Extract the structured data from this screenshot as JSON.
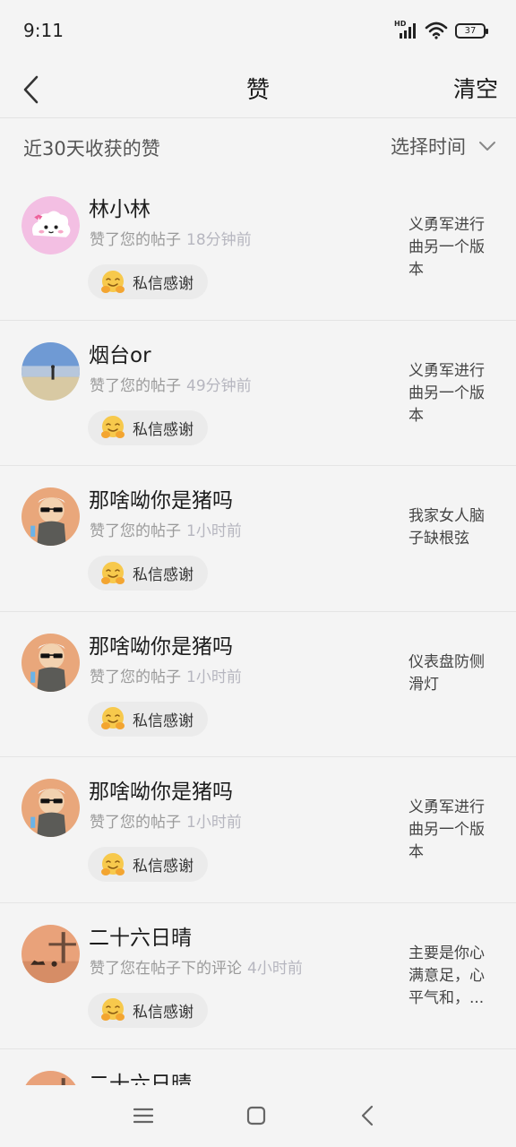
{
  "status_bar": {
    "time": "9:11",
    "network": "HD",
    "battery": "37"
  },
  "header": {
    "title": "赞",
    "clear": "清空"
  },
  "filter": {
    "label": "近30天收获的赞",
    "time_picker": "选择时间"
  },
  "likes": [
    {
      "user": "林小林",
      "action": "赞了您的帖子",
      "time": "18分钟前",
      "thanks": "私信感谢",
      "post": "义勇军进行曲另一个版本",
      "avatar": "cloud"
    },
    {
      "user": "烟台or",
      "action": "赞了您的帖子",
      "time": "49分钟前",
      "thanks": "私信感谢",
      "post": "义勇军进行曲另一个版本",
      "avatar": "beach"
    },
    {
      "user": "那啥呦你是猪吗",
      "action": "赞了您的帖子",
      "time": "1小时前",
      "thanks": "私信感谢",
      "post": "我家女人脑子缺根弦",
      "avatar": "cartoon"
    },
    {
      "user": "那啥呦你是猪吗",
      "action": "赞了您的帖子",
      "time": "1小时前",
      "thanks": "私信感谢",
      "post": "仪表盘防侧滑灯",
      "avatar": "cartoon"
    },
    {
      "user": "那啥呦你是猪吗",
      "action": "赞了您的帖子",
      "time": "1小时前",
      "thanks": "私信感谢",
      "post": "义勇军进行曲另一个版本",
      "avatar": "cartoon"
    },
    {
      "user": "二十六日晴",
      "action": "赞了您在帖子下的评论",
      "time": "4小时前",
      "thanks": "私信感谢",
      "post": "主要是你心满意足，心平气和，...",
      "avatar": "sunset"
    },
    {
      "user": "二十六日晴",
      "action": "",
      "time": "",
      "thanks": "",
      "post": "",
      "avatar": "sunset"
    }
  ],
  "icons": {
    "back": "chevron-left-icon",
    "time_picker": "chevron-down-icon",
    "thanks": "hug-emoji-icon"
  },
  "colors": {
    "background": "#f4f4f4",
    "divider": "#e4e4e4",
    "muted_text": "#9a9a9a",
    "time_text": "#b6b6bf",
    "chip_bg": "#ebebeb"
  }
}
